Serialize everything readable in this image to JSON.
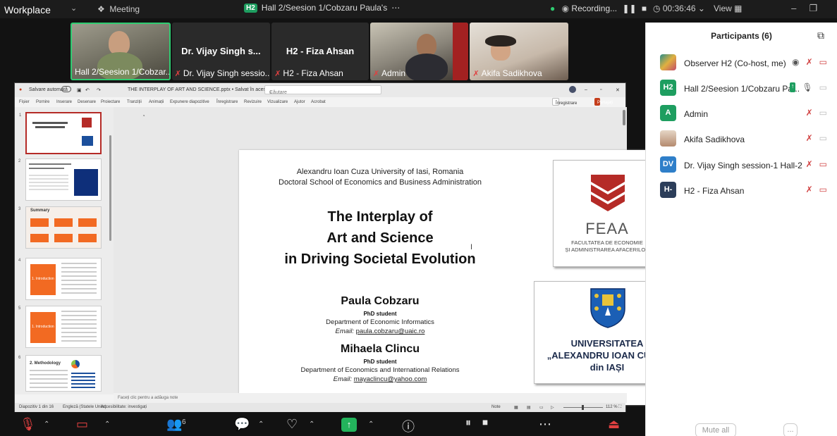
{
  "topbar": {
    "workspace": "Workplace",
    "meeting": "Meeting",
    "badge": "H2",
    "title": "Hall 2/Seesion 1/Cobzaru Paula's",
    "recording": "Recording...",
    "timer": "00:36:46",
    "view": "View"
  },
  "videos": [
    {
      "name": "Hall 2/Seesion 1/Cobzar..."
    },
    {
      "name": "Dr. Vijay Singh sessio...",
      "big": "Dr. Vijay Singh s..."
    },
    {
      "name": "H2 - Fiza Ahsan",
      "big": "H2 - Fiza Ahsan"
    },
    {
      "name": "Admin"
    },
    {
      "name": "Akifa Sadikhova"
    }
  ],
  "ppt": {
    "autosave": "Salvare automată",
    "filename": "THE INTERPLAY OF ART AND SCIENCE.pptx • Salvat în acest PC",
    "search": "Căutare",
    "menu": [
      "Fișier",
      "Pornire",
      "Inserare",
      "Desenare",
      "Proiectare",
      "Tranziții",
      "Animații",
      "Expunere diapozitive",
      "Înregistrare",
      "Revizuire",
      "Vizualizare",
      "Ajutor",
      "Acrobat"
    ],
    "record_btn": "Înregistrare",
    "share_btn": "Partajați",
    "notes": "Faceți clic pentru a adăuga note",
    "status_slide": "Diapozitiv 1 din 16",
    "status_lang": "Engleză (Statele Unite)",
    "status_access": "Accesibilitate: investigați",
    "status_notes": "Note",
    "zoom": "112 %",
    "thumb_nums": [
      "1",
      "2",
      "3",
      "4",
      "5",
      "6"
    ],
    "thumb_labels": {
      "summary": "Summary",
      "intro1": "1. Introduction",
      "intro2": "1. Introduction",
      "method": "2. Methodology"
    }
  },
  "slide": {
    "uni1": "Alexandru Ioan Cuza University of Iasi, Romania",
    "uni2": "Doctoral School of Economics and Business Administration",
    "title1": "The Interplay of",
    "title2": "Art and Science",
    "title3": "in Driving Societal Evolution",
    "author1": "Paula Cobzaru",
    "role1": "PhD student",
    "dept1": "Department of Economic Informatics",
    "email_label1": "Email:",
    "email1": "paula.cobzaru@uaic.ro",
    "author2": "Mihaela Clincu",
    "role2": "PhD student",
    "dept2": "Department of Economics and International Relations",
    "email_label2": "Email:",
    "email2": "mayaclincu@yahoo.com",
    "feaa_title": "FEAA",
    "feaa_sub1": "FACULTATEA DE ECONOMIE",
    "feaa_sub2": "ȘI ADMINISTRAREA AFACERILOR",
    "uaic1": "UNIVERSITATEA",
    "uaic2": "„ALEXANDRU IOAN CUZA“",
    "uaic3": "din IAȘI"
  },
  "participants": {
    "header": "Participants (6)",
    "list": [
      {
        "initials": "",
        "name": "Observer H2 (Co-host, me)",
        "color": "#3a7bd5"
      },
      {
        "initials": "H2",
        "name": "Hall 2/Seesion 1/Cobzaru Pa...",
        "color": "#1e9e60"
      },
      {
        "initials": "A",
        "name": "Admin",
        "color": "#1e9e60"
      },
      {
        "initials": "",
        "name": "Akifa Sadikhova",
        "color": "#c08a6a"
      },
      {
        "initials": "DV",
        "name": "Dr. Vijay Singh session-1 Hall-2",
        "color": "#2f7fc9"
      },
      {
        "initials": "H-",
        "name": "H2 - Fiza Ahsan",
        "color": "#2c3e5a"
      }
    ],
    "mute_all": "Mute all",
    "more": "..."
  },
  "toolbar": {
    "participants_count": "6"
  },
  "colors": {
    "accent_green": "#23b45c",
    "mic_off": "#d04040",
    "ppt_red": "#b52b27",
    "orange": "#f26a22"
  }
}
